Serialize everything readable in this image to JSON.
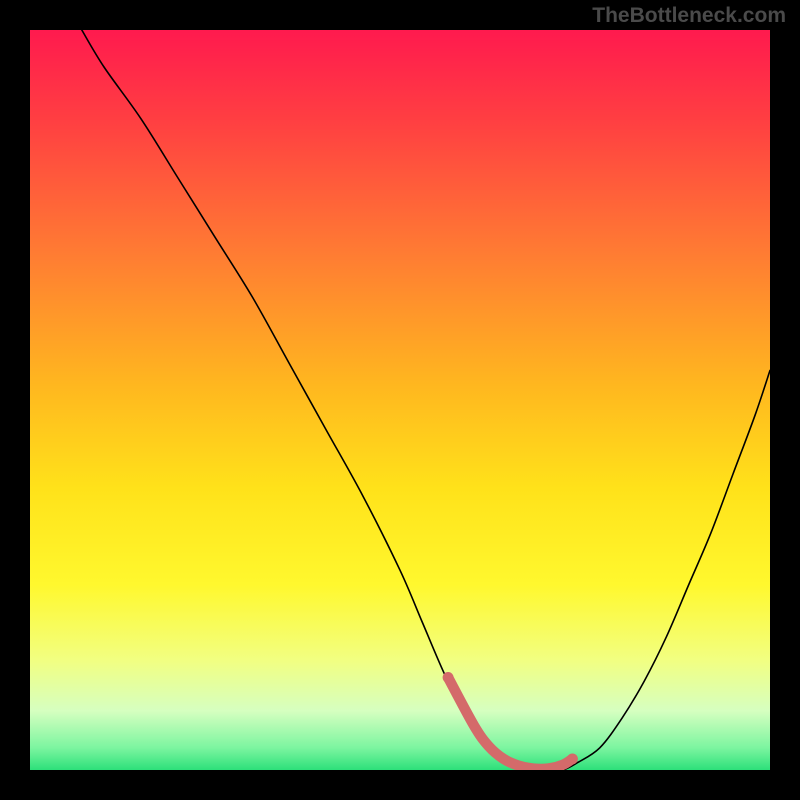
{
  "attribution": "TheBottleneck.com",
  "chart_data": {
    "type": "line",
    "title": "",
    "xlabel": "",
    "ylabel": "",
    "xlim": [
      0,
      100
    ],
    "ylim": [
      0,
      100
    ],
    "background_gradient": {
      "type": "vertical",
      "stops": [
        {
          "offset": 0.0,
          "color": "#ff1a4e"
        },
        {
          "offset": 0.12,
          "color": "#ff3e42"
        },
        {
          "offset": 0.3,
          "color": "#ff7b33"
        },
        {
          "offset": 0.48,
          "color": "#ffb71f"
        },
        {
          "offset": 0.62,
          "color": "#ffe21a"
        },
        {
          "offset": 0.75,
          "color": "#fff82e"
        },
        {
          "offset": 0.85,
          "color": "#f2ff80"
        },
        {
          "offset": 0.92,
          "color": "#d6ffc0"
        },
        {
          "offset": 0.97,
          "color": "#7cf5a0"
        },
        {
          "offset": 1.0,
          "color": "#2de07a"
        }
      ]
    },
    "series": [
      {
        "name": "bottleneck-curve",
        "color": "#000000",
        "width": 1.6,
        "x": [
          7,
          10,
          15,
          20,
          25,
          30,
          35,
          40,
          45,
          50,
          53,
          56,
          59,
          62,
          65,
          68,
          70,
          72,
          74,
          77,
          80,
          83,
          86,
          89,
          92,
          95,
          98,
          100
        ],
        "values": [
          100,
          95,
          88,
          80,
          72,
          64,
          55,
          46,
          37,
          27,
          20,
          13,
          7,
          3,
          1,
          0,
          0,
          0,
          1,
          3,
          7,
          12,
          18,
          25,
          32,
          40,
          48,
          54
        ]
      }
    ],
    "markers": {
      "name": "highlight-band",
      "color": "#d46a6a",
      "radius": 5.2,
      "x": [
        56.5,
        60,
        62,
        64,
        66,
        68,
        70,
        72,
        73.3
      ],
      "values": [
        12.5,
        6,
        3.2,
        1.5,
        0.6,
        0.2,
        0.2,
        0.7,
        1.5
      ]
    }
  }
}
